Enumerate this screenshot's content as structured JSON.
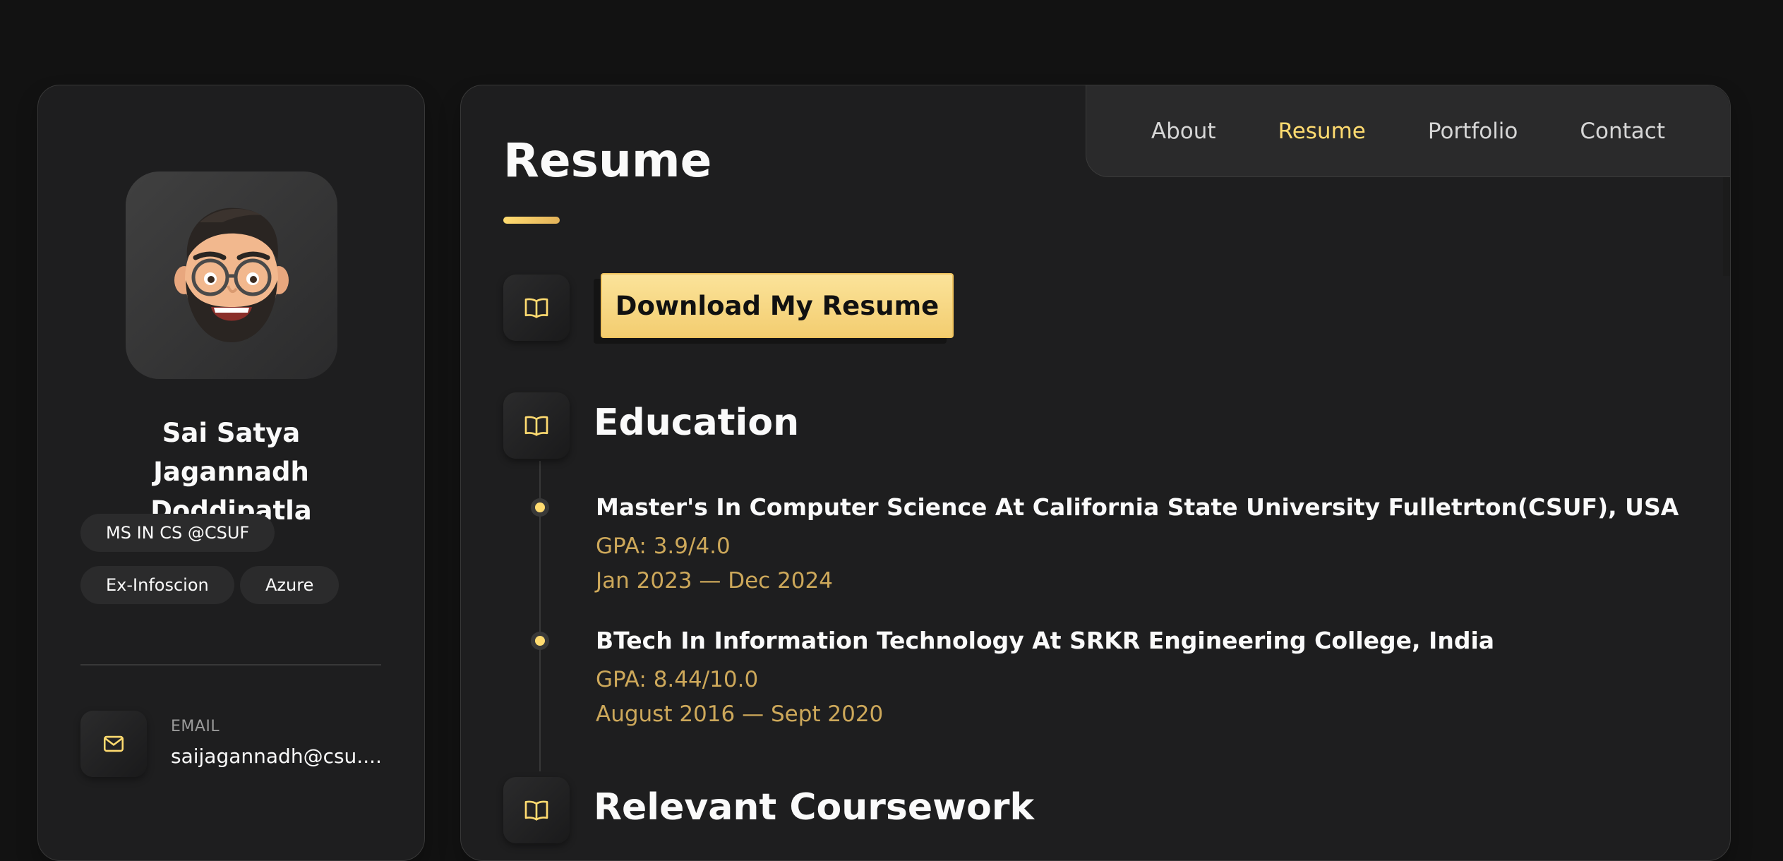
{
  "sidebar": {
    "avatar_alt": "avatar",
    "name": "Sai Satya Jagannadh Doddipatla",
    "chips": [
      "MS IN CS @CSUF",
      "Ex-Infoscion",
      "Azure"
    ],
    "contact": {
      "label": "EMAIL",
      "value": "saijagannadh@csu....",
      "icon": "mail-icon"
    }
  },
  "nav": {
    "items": [
      "About",
      "Resume",
      "Portfolio",
      "Contact"
    ],
    "active": "Resume"
  },
  "main": {
    "title": "Resume",
    "download_label": "Download My Resume",
    "education": {
      "title": "Education",
      "items": [
        {
          "title": "Master's In Computer Science At California State University Fulletrton(CSUF), USA",
          "gpa": "GPA: 3.9/4.0",
          "dates": "Jan 2023 — Dec 2024"
        },
        {
          "title": "BTech In Information Technology At SRKR Engineering College, India",
          "gpa": "GPA: 8.44/10.0",
          "dates": "August 2016 — Sept 2020"
        }
      ]
    },
    "coursework": {
      "title": "Relevant Coursework"
    }
  },
  "colors": {
    "accent": "#ffdb70",
    "sub_text": "#cda85a",
    "background": "#121212",
    "card": "#1e1e1f"
  }
}
